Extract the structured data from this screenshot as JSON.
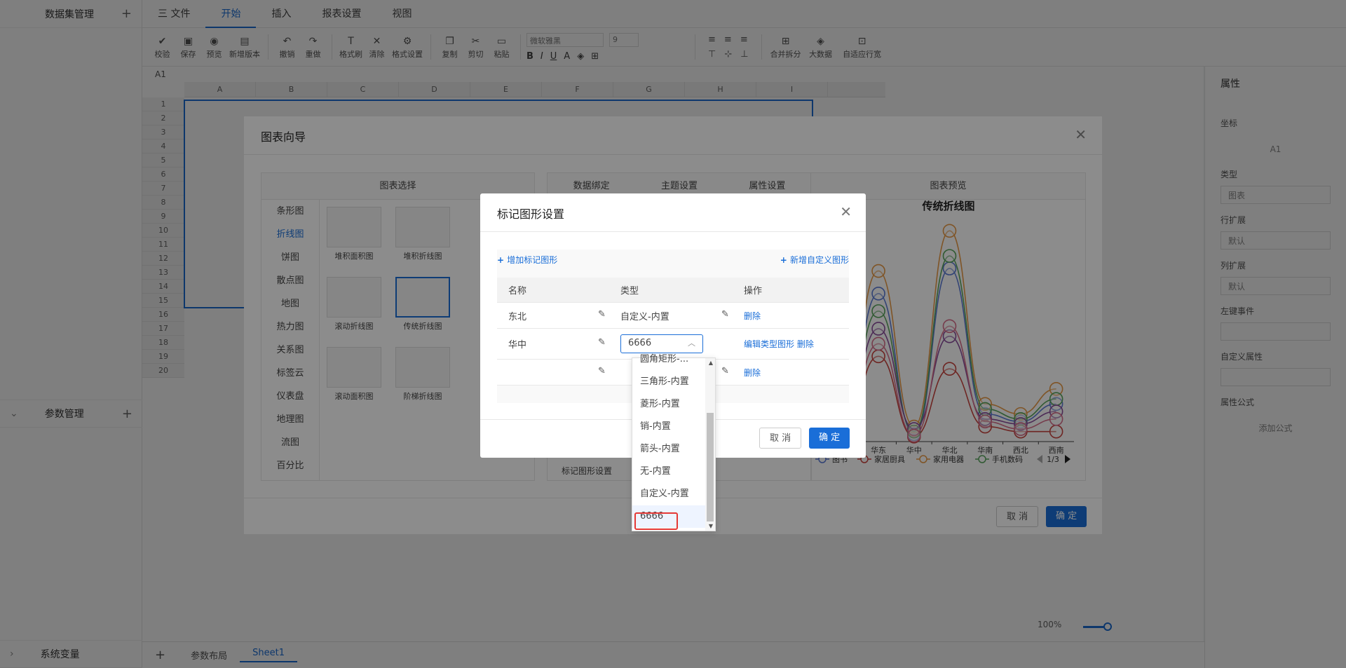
{
  "left_panel": {
    "title": "数据集管理",
    "params": "参数管理",
    "sysvars": "系统变量"
  },
  "menu": {
    "file": "三 文件",
    "tabs": [
      "开始",
      "插入",
      "报表设置",
      "视图"
    ]
  },
  "toolbar": {
    "items": [
      "校验",
      "保存",
      "预览",
      "新增版本",
      "撤销",
      "重做",
      "格式刷",
      "清除",
      "格式设置",
      "复制",
      "剪切",
      "粘贴"
    ],
    "font": "微软雅黑",
    "size": "9",
    "right": [
      "合并拆分",
      "大数据",
      "自适应行宽"
    ]
  },
  "sheet": {
    "cell_ref": "A1",
    "cols": [
      "A",
      "B",
      "C",
      "D",
      "E",
      "F",
      "G",
      "H",
      "I"
    ],
    "rows": [
      "1",
      "2",
      "3",
      "4",
      "5",
      "6",
      "7",
      "8",
      "9",
      "10",
      "11",
      "12",
      "13",
      "14",
      "15",
      "16",
      "17",
      "18",
      "19",
      "20"
    ]
  },
  "right_panel": {
    "title": "属性",
    "coord_label": "坐标",
    "coord": "A1",
    "type_label": "类型",
    "type": "图表",
    "row_label": "行扩展",
    "row": "默认",
    "col_label": "列扩展",
    "col": "默认",
    "event": "左键事件",
    "custom": "自定义属性",
    "formula": "属性公式",
    "add_formula": "添加公式"
  },
  "bottom": {
    "layout": "参数布局",
    "sheet": "Sheet1",
    "zoom": "100%"
  },
  "wizard": {
    "title": "图表向导",
    "left_header": "图表选择",
    "types": [
      "条形图",
      "折线图",
      "饼图",
      "散点图",
      "地图",
      "热力图",
      "关系图",
      "标签云",
      "仪表盘",
      "地理图",
      "流图",
      "百分比"
    ],
    "active_type": "折线图",
    "thumbs": [
      "堆积面积图",
      "堆积折线图",
      "滚动折线图",
      "传统折线图",
      "滚动面积图",
      "阶梯折线图"
    ],
    "mid_tabs": [
      "数据绑定",
      "主题设置",
      "属性设置"
    ],
    "mid_bottom": "标记图形设置",
    "preview_header": "图表预览",
    "cancel": "取 消",
    "ok": "确 定"
  },
  "chart_data": {
    "type": "line",
    "title": "传统折线图",
    "categories": [
      "东北",
      "华东",
      "华中",
      "华北",
      "华南",
      "西北",
      "西南"
    ],
    "series": [
      {
        "name": "图书",
        "values": [
          30,
          295,
          15,
          345,
          55,
          40,
          75
        ]
      },
      {
        "name": "家居厨具",
        "values": [
          20,
          170,
          10,
          145,
          30,
          20,
          20
        ]
      },
      {
        "name": "家用电器",
        "values": [
          50,
          340,
          30,
          420,
          75,
          55,
          105
        ]
      },
      {
        "name": "手机数码",
        "values": [
          40,
          260,
          20,
          370,
          65,
          45,
          85
        ]
      }
    ],
    "extra_series": [
      {
        "values": [
          35,
          225,
          25,
          210,
          45,
          35,
          60
        ]
      },
      {
        "values": [
          25,
          195,
          12,
          230,
          40,
          25,
          45
        ]
      }
    ],
    "page": "1/3"
  },
  "dialog": {
    "title": "标记图形设置",
    "add_marker": "增加标记图形",
    "add_custom": "新增自定义图形",
    "headers": [
      "名称",
      "类型",
      "操作"
    ],
    "rows": [
      {
        "name": "东北",
        "type": "自定义-内置",
        "ops": "删除"
      },
      {
        "name": "华中",
        "type": "6666",
        "ops": "编辑类型图形 删除"
      },
      {
        "name": "",
        "type": "",
        "ops": "删除"
      }
    ],
    "cancel": "取 消",
    "ok": "确 定"
  },
  "dropdown": {
    "options": [
      "圆角矩形-...",
      "三角形-内置",
      "菱形-内置",
      "销-内置",
      "箭头-内置",
      "无-内置",
      "自定义-内置",
      "6666"
    ],
    "selected": "6666"
  },
  "colors": {
    "accent": "#1a6ed8",
    "highlight": "#e53935",
    "s1": "#5b7bd5",
    "s2": "#c8443f",
    "s3": "#e89a45",
    "s4": "#58a55c",
    "s5": "#8a4d9b",
    "s6": "#d76d8a"
  }
}
